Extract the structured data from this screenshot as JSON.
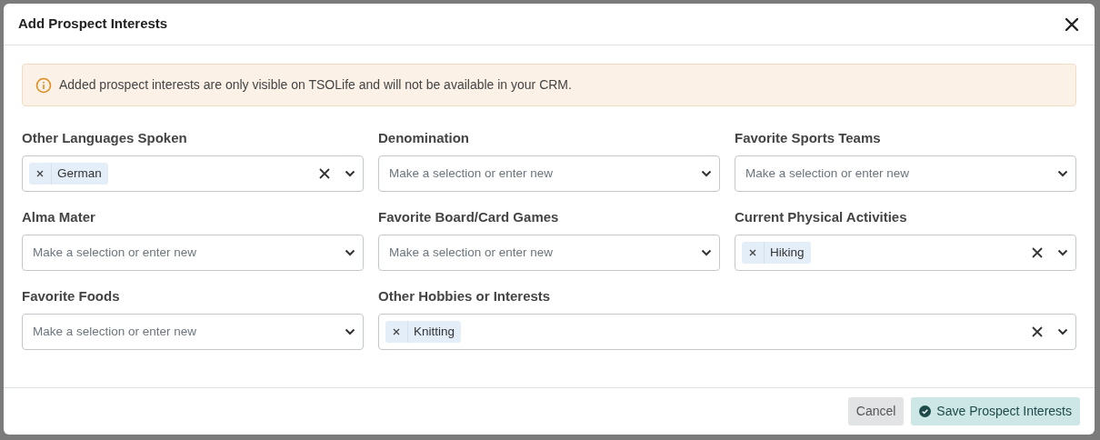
{
  "modal": {
    "title": "Add Prospect Interests"
  },
  "alert": {
    "text": "Added prospect interests are only visible on TSOLife and will not be available in your CRM."
  },
  "fields": [
    {
      "label": "Other Languages Spoken",
      "values": [
        "German"
      ],
      "wide": false
    },
    {
      "label": "Denomination",
      "placeholder": "Make a selection or enter new",
      "wide": false
    },
    {
      "label": "Favorite Sports Teams",
      "placeholder": "Make a selection or enter new",
      "wide": false
    },
    {
      "label": "Alma Mater",
      "placeholder": "Make a selection or enter new",
      "wide": false
    },
    {
      "label": "Favorite Board/Card Games",
      "placeholder": "Make a selection or enter new",
      "wide": false
    },
    {
      "label": "Current Physical Activities",
      "values": [
        "Hiking"
      ],
      "wide": false
    },
    {
      "label": "Favorite Foods",
      "placeholder": "Make a selection or enter new",
      "wide": false
    },
    {
      "label": "Other Hobbies or Interests",
      "values": [
        "Knitting"
      ],
      "wide": true
    }
  ],
  "buttons": [
    {
      "label": "Cancel",
      "kind": "secondary"
    },
    {
      "label": "Save Prospect Interests",
      "kind": "primary"
    }
  ]
}
